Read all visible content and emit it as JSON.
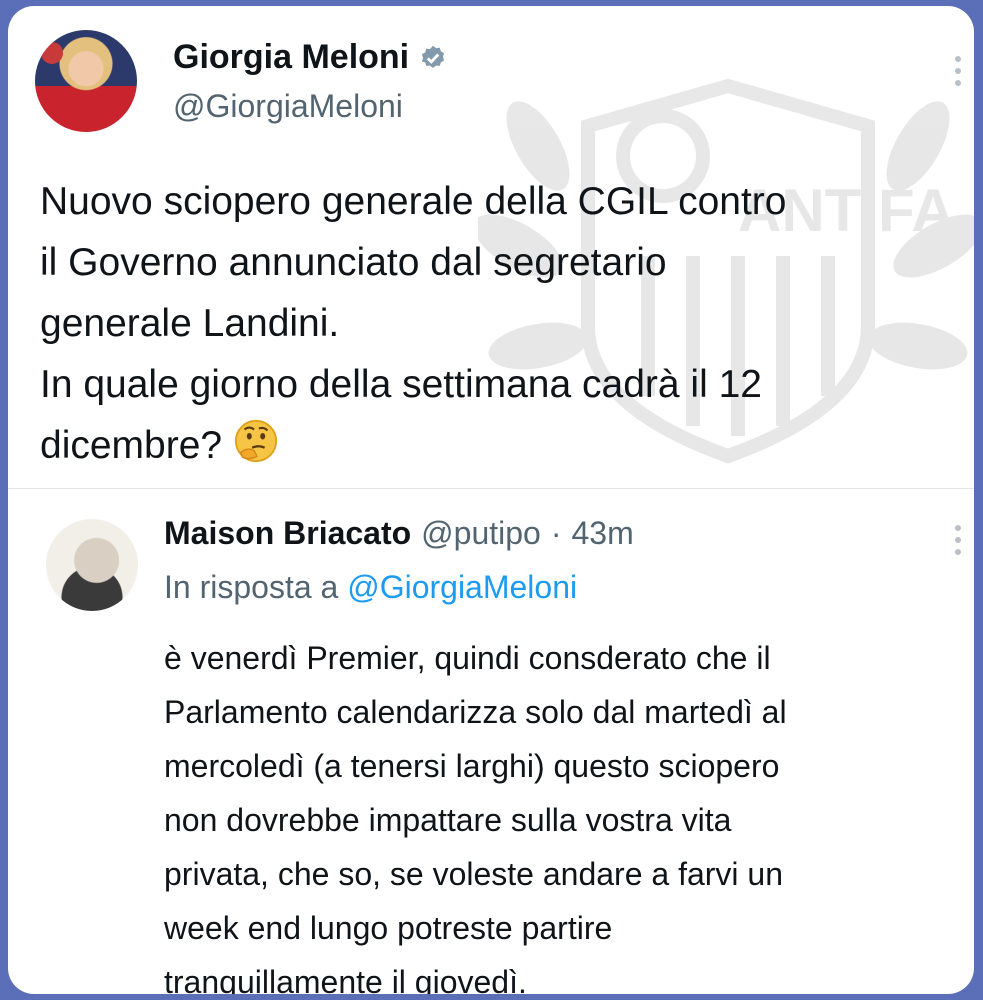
{
  "post": {
    "author_name": "Giorgia Meloni",
    "author_handle": "@GiorgiaMeloni",
    "verified_icon": "verified-badge-icon",
    "text": "Nuovo sciopero generale della CGIL contro\nil Governo annunciato dal segretario\ngenerale Landini.\nIn quale giorno della settimana cadrà il 12\ndicembre?",
    "emoji": "thinking-face-icon"
  },
  "reply": {
    "author_name": "Maison Briacato",
    "author_handle": "@putipo",
    "separator": "·",
    "time": "43m",
    "in_reply_prefix": "In risposta a",
    "in_reply_handle": "@GiorgiaMeloni",
    "text": "è venerdì Premier, quindi consderato che il\nParlamento calendarizza solo dal martedì al\nmercoledì (a tenersi larghi) questo sciopero\nnon dovrebbe impattare sulla vostra vita\nprivata, che so, se voleste andare a farvi un\nweek end lungo potreste partire\ntranquillamente il giovedì."
  },
  "watermark": {
    "text": "ANTIFA"
  },
  "colors": {
    "border": "#5b6fb8",
    "link": "#1d9bf0",
    "muted": "#536471",
    "verified": "#829aab"
  }
}
